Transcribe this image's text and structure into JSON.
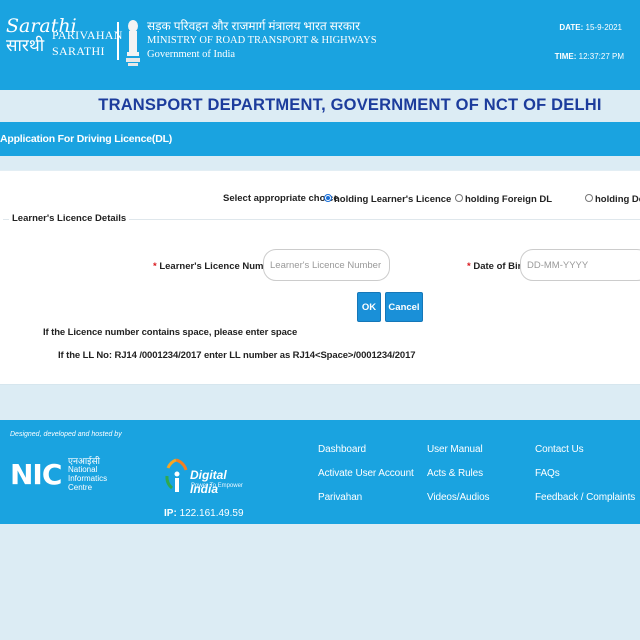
{
  "header": {
    "logo_sarathi_line1": "Sarathi",
    "logo_sarathi_line2": "सारथी",
    "parivahan_line1": "PARIVAHAN",
    "parivahan_line2": "SARATHI",
    "ministry_hindi": "सड़क परिवहन और राजमार्ग मंत्रालय भारत सरकार",
    "ministry_english": "MINISTRY OF ROAD TRANSPORT & HIGHWAYS",
    "government": "Government of India",
    "date_label": "DATE:",
    "date_value": "15-9-2021",
    "time_label": "TIME:",
    "time_value": "12:37:27 PM"
  },
  "department_title": "TRANSPORT DEPARTMENT, GOVERNMENT OF NCT OF DELHI",
  "application_bar": "Application For Driving Licence(DL)",
  "form": {
    "choice_label": "Select appropriate choice",
    "options": [
      {
        "label": "holding Learner's Licence",
        "checked": true
      },
      {
        "label": "holding Foreign DL",
        "checked": false
      },
      {
        "label": "holding Defe",
        "checked": false
      }
    ],
    "legend": "Learner's Licence Details",
    "ll_number_label": "Learner's Licence Number",
    "ll_number_placeholder": "Learner's Licence Number",
    "dob_label": "Date of Birth",
    "dob_placeholder": "DD-MM-YYYY",
    "required_mark": "*",
    "ok_label": "OK",
    "cancel_label": "Cancel",
    "note1": "If the Licence number contains space, please enter space",
    "note2": "If the LL No: RJ14 /0001234/2017 enter LL number as RJ14<Space>/0001234/2017"
  },
  "footer": {
    "designed_by": "Designed, developed and hosted by",
    "nic_letters": "NIC",
    "nic_hindi": "एनआईसी",
    "nic_line1": "National",
    "nic_line2": "Informatics",
    "nic_line3": "Centre",
    "digital_india": "Digital India",
    "digital_india_tag": "Power To Empower",
    "ip_label": "IP:",
    "ip_value": "122.161.49.59",
    "links_col1": [
      "Dashboard",
      "Activate User Account",
      "Parivahan"
    ],
    "links_col2": [
      "User Manual",
      "Acts & Rules",
      "Videos/Audios"
    ],
    "links_col3": [
      "Contact Us",
      "FAQs",
      "Feedback / Complaints"
    ]
  },
  "colors": {
    "brand_blue": "#1aa3e0",
    "title_navy": "#1c3c9c",
    "button_blue": "#1a90d8",
    "required_red": "#d9181e",
    "page_bg": "#dcecf4"
  }
}
